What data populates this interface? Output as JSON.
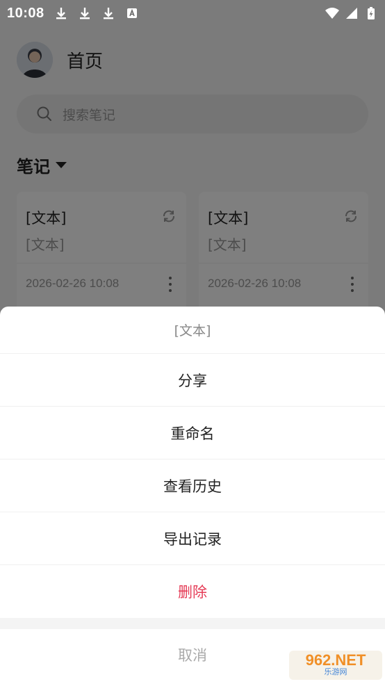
{
  "status_bar": {
    "time": "10:08",
    "notification_icons": [
      "download-icon",
      "download-icon",
      "download-icon",
      "a-icon"
    ],
    "system_icons": [
      "wifi-icon",
      "signal-icon",
      "battery-charging-icon"
    ]
  },
  "header": {
    "title": "首页"
  },
  "search": {
    "placeholder": "搜索笔记"
  },
  "section": {
    "title": "笔记"
  },
  "notes": [
    {
      "title": "[文本]",
      "subtitle": "[文本]",
      "date": "2026-02-26 10:08"
    },
    {
      "title": "[文本]",
      "subtitle": "[文本]",
      "date": "2026-02-26 10:08"
    }
  ],
  "sheet": {
    "title": "[文本]",
    "items": [
      "分享",
      "重命名",
      "查看历史",
      "导出记录",
      "删除"
    ],
    "cancel": "取消"
  },
  "watermark": {
    "main": "962.NET",
    "sub": "乐游网"
  },
  "colors": {
    "danger": "#e53a55",
    "overlay": "rgba(0,0,0,0.5)"
  }
}
